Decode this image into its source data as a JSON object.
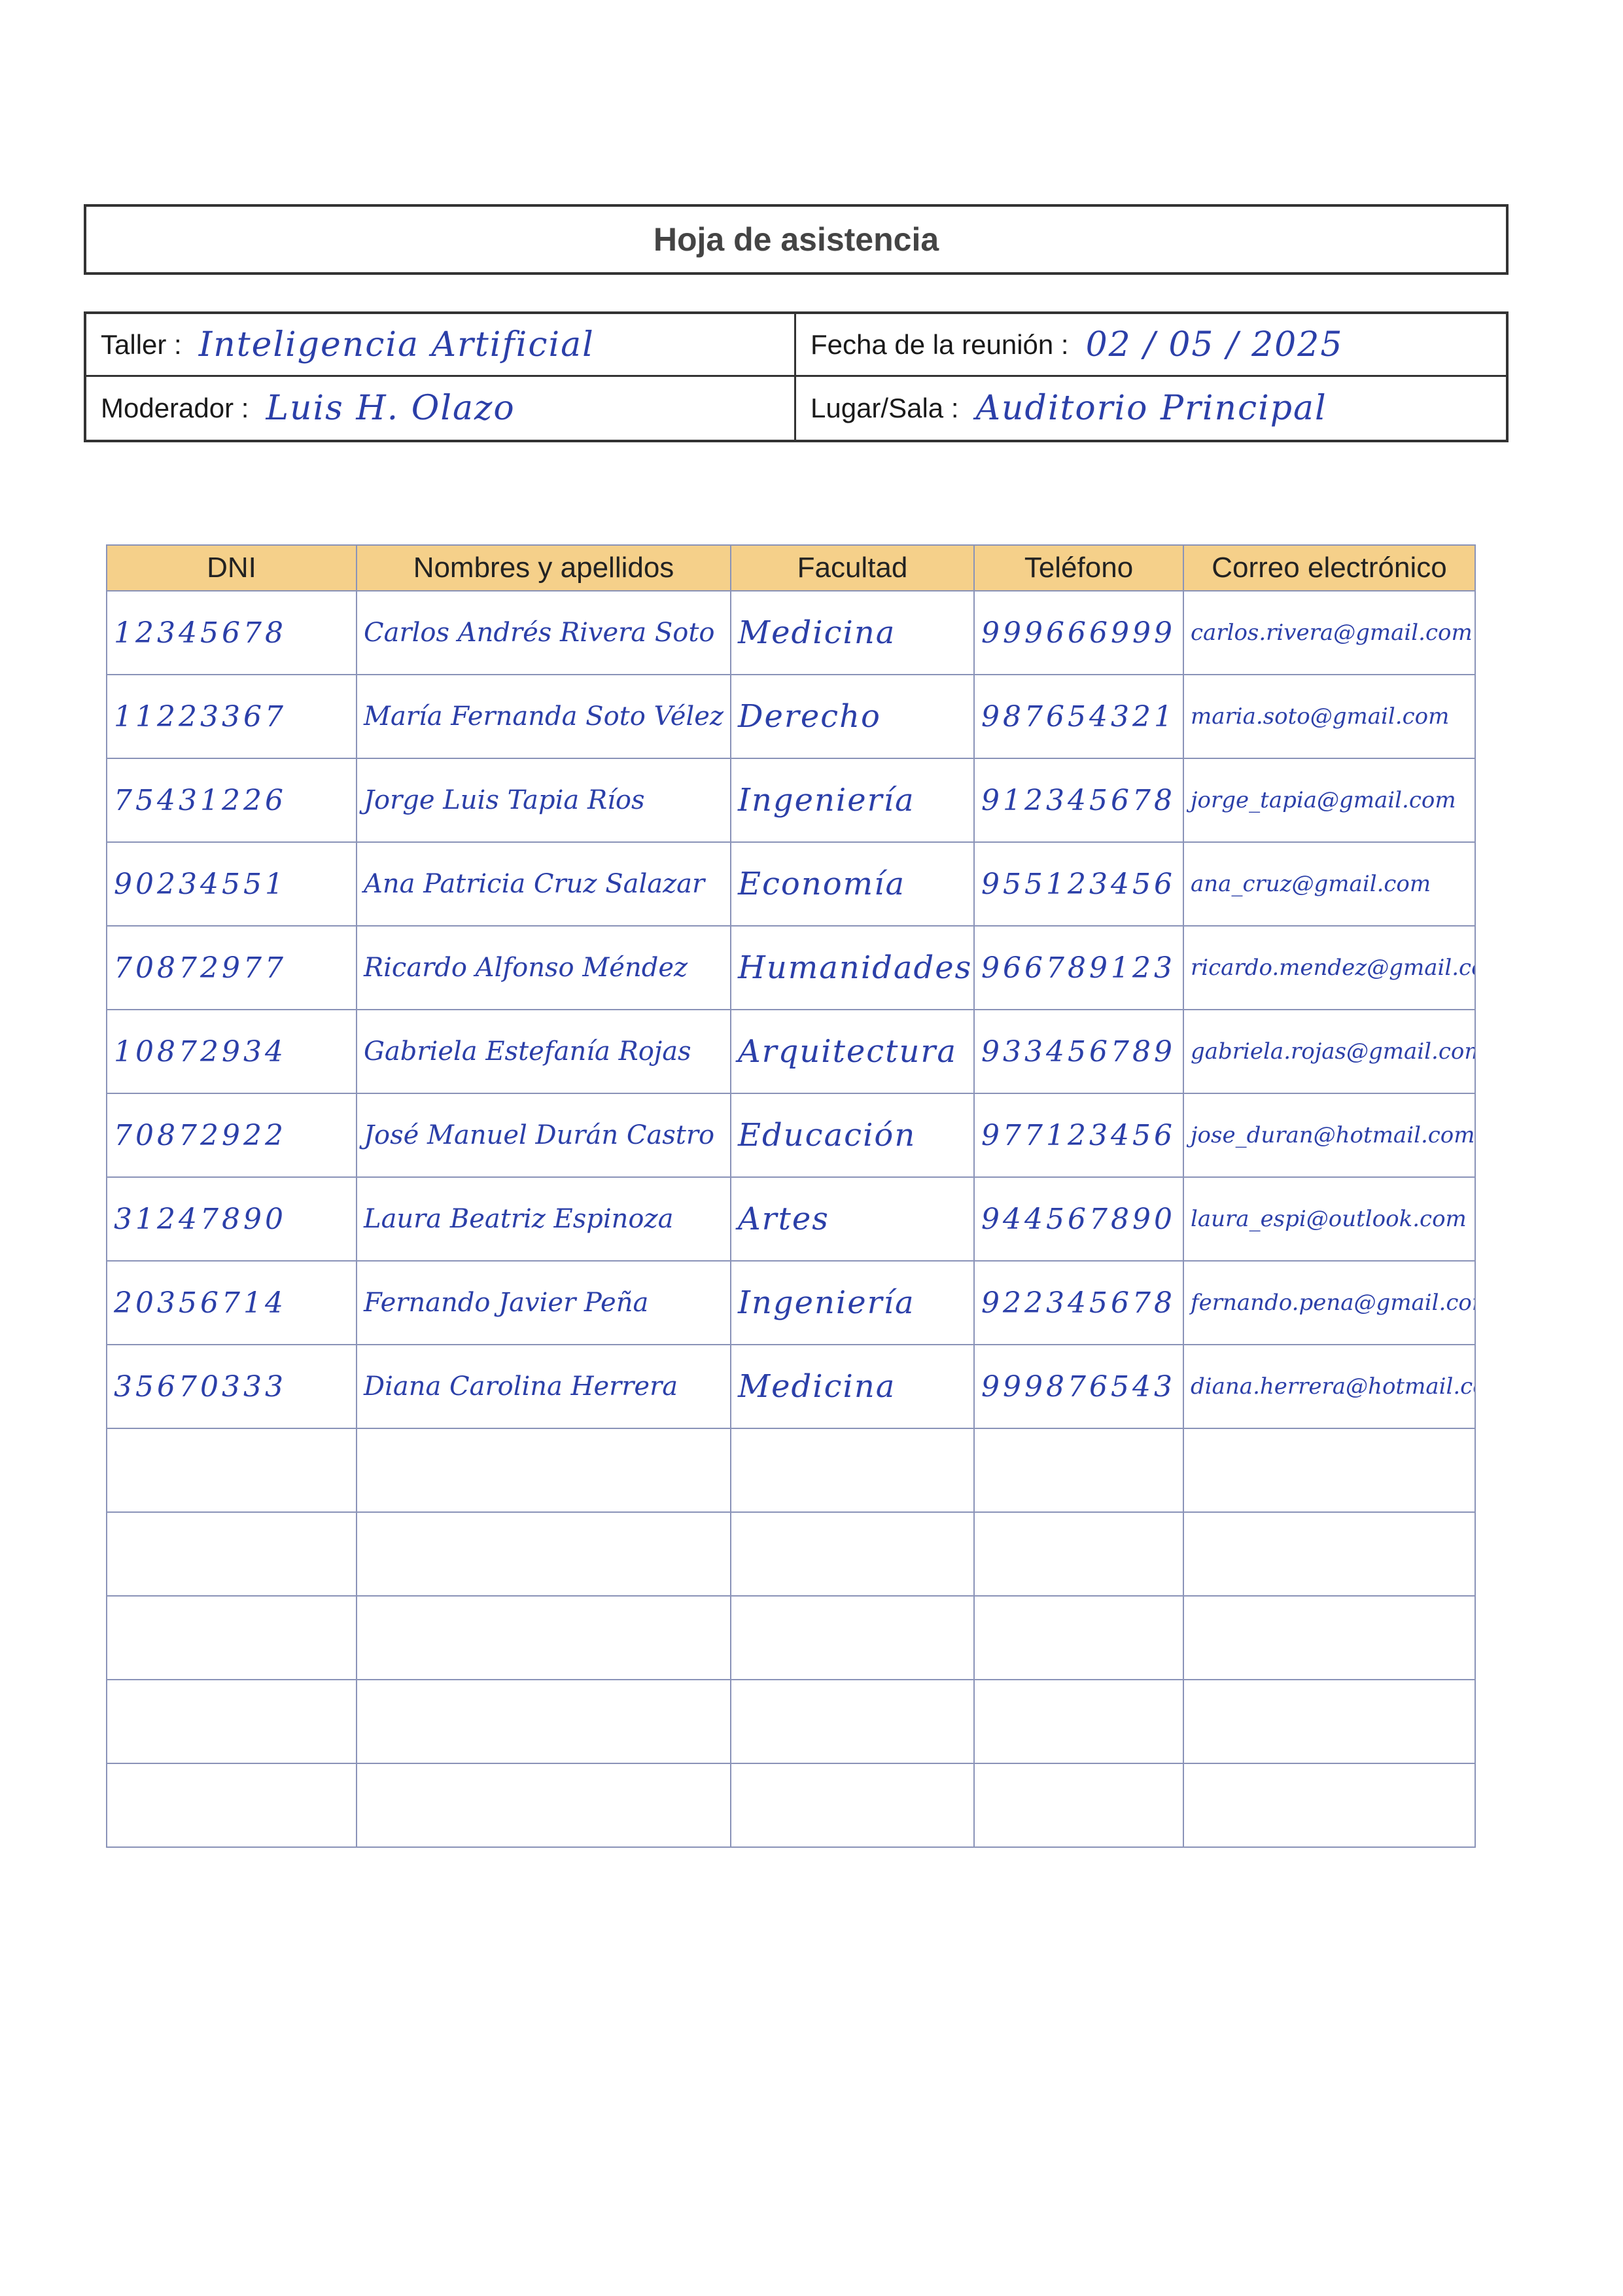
{
  "header": {
    "title": "Hoja de asistencia"
  },
  "info": {
    "taller_label": "Taller :",
    "taller_value": "Inteligencia Artificial",
    "fecha_label": "Fecha de la reunión :",
    "fecha_value": "02 / 05 / 2025",
    "moderador_label": "Moderador :",
    "moderador_value": "Luis H. Olazo",
    "lugar_label": "Lugar/Sala :",
    "lugar_value": "Auditorio Principal"
  },
  "table": {
    "columns": [
      "DNI",
      "Nombres y apellidos",
      "Facultad",
      "Teléfono",
      "Correo electrónico"
    ],
    "rows": [
      [
        "12345678",
        "Carlos Andrés Rivera Soto",
        "Medicina",
        "999666999",
        "carlos.rivera@gmail.com"
      ],
      [
        "11223367",
        "María Fernanda Soto Vélez",
        "Derecho",
        "987654321",
        "maria.soto@gmail.com"
      ],
      [
        "75431226",
        "Jorge Luis Tapia Ríos",
        "Ingeniería",
        "912345678",
        "jorge_tapia@gmail.com"
      ],
      [
        "90234551",
        "Ana Patricia Cruz Salazar",
        "Economía",
        "955123456",
        "ana_cruz@gmail.com"
      ],
      [
        "70872977",
        "Ricardo Alfonso Méndez",
        "Humanidades",
        "966789123",
        "ricardo.mendez@gmail.com"
      ],
      [
        "10872934",
        "Gabriela Estefanía Rojas",
        "Arquitectura",
        "933456789",
        "gabriela.rojas@gmail.com"
      ],
      [
        "70872922",
        "José Manuel Durán Castro",
        "Educación",
        "977123456",
        "jose_duran@hotmail.com"
      ],
      [
        "31247890",
        "Laura Beatriz Espinoza",
        "Artes",
        "944567890",
        "laura_espi@outlook.com"
      ],
      [
        "20356714",
        "Fernando Javier Peña",
        "Ingeniería",
        "922345678",
        "fernando.pena@gmail.com"
      ],
      [
        "35670333",
        "Diana Carolina Herrera",
        "Medicina",
        "999876543",
        "diana.herrera@hotmail.com"
      ],
      [
        "",
        "",
        "",
        "",
        ""
      ],
      [
        "",
        "",
        "",
        "",
        ""
      ],
      [
        "",
        "",
        "",
        "",
        ""
      ],
      [
        "",
        "",
        "",
        "",
        ""
      ],
      [
        "",
        "",
        "",
        "",
        ""
      ]
    ]
  }
}
